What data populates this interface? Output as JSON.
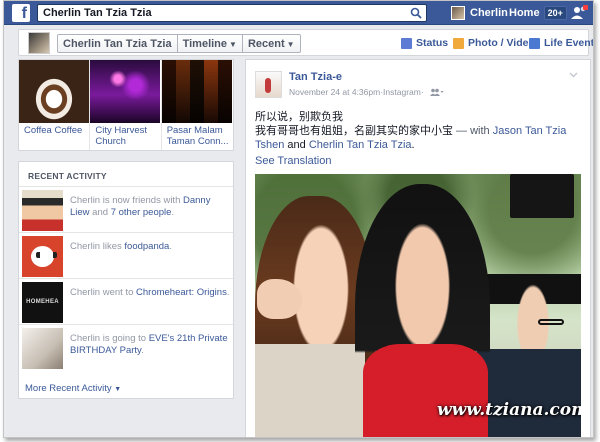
{
  "topbar": {
    "search_value": "Cherlin Tan Tzia Tzia",
    "user_name": "Cherlin",
    "home_label": "Home",
    "home_badge": "20+"
  },
  "timeline_bar": {
    "profile_name": "Cherlin Tan Tzia Tzia",
    "timeline_label": "Timeline",
    "recent_label": "Recent",
    "status_label": "Status",
    "photo_video_label": "Photo / Video",
    "life_event_label": "Life Event"
  },
  "photos": [
    {
      "caption": "Coffea Coffee"
    },
    {
      "caption": "City Harvest Church"
    },
    {
      "caption": "Pasar Malam Taman Conn..."
    }
  ],
  "recent_activity": {
    "header": "RECENT ACTIVITY",
    "items": [
      {
        "prefix": "Cherlin is now friends with ",
        "link1": "Danny Liew",
        "mid": " and ",
        "link2": "7 other people",
        "suffix": "."
      },
      {
        "prefix": "Cherlin likes ",
        "link1": "foodpanda",
        "mid": "",
        "link2": "",
        "suffix": "."
      },
      {
        "prefix": "Cherlin went to ",
        "link1": "Chromeheart: Origins",
        "mid": "",
        "link2": "",
        "suffix": "."
      },
      {
        "prefix": "Cherlin is going to ",
        "link1": "EVE's 21th Private BIRTHDAY Party",
        "mid": "",
        "link2": "",
        "suffix": "."
      }
    ],
    "thumb_text_chromeheart": "HOMEHEA",
    "more_label": "More Recent Activity"
  },
  "post": {
    "author": "Tan Tzia-e",
    "date": "November 24 at 4:36pm",
    "separator": " · ",
    "source": "Instagram",
    "line1": "所以说，别欺负我",
    "line2": "我有哥哥也有姐姐，名副其实的家中小宝",
    "with_text": " — with ",
    "tag1": "Jason Tan Tzia Tshen",
    "and_text": " and ",
    "tag2": "Cherlin Tan Tzia Tzia",
    "end": ".",
    "see_translation": "See Translation",
    "watermark": "www.tziana.com"
  },
  "colors": {
    "brand_blue": "#3b5998",
    "link": "#3b5998",
    "muted": "#9197a3"
  },
  "icons": [
    "search-icon",
    "friends-icon",
    "status-icon",
    "photo-icon",
    "life-event-icon",
    "audience-icon",
    "chevron-down-icon"
  ]
}
